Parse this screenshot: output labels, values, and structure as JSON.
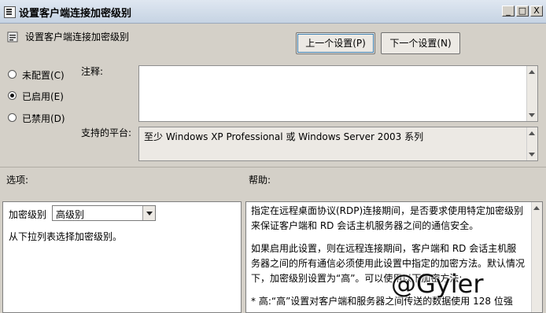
{
  "window": {
    "title": "设置客户端连接加密级别",
    "controls": {
      "minimize": "_",
      "maximize": "□",
      "close": "X"
    }
  },
  "header": {
    "setting_name": "设置客户端连接加密级别"
  },
  "nav": {
    "prev_label": "上一个设置(P)",
    "next_label": "下一个设置(N)"
  },
  "radio": {
    "not_configured": "未配置(C)",
    "enabled": "已启用(E)",
    "disabled": "已禁用(D)",
    "selected": "enabled"
  },
  "comment": {
    "label": "注释:",
    "value": ""
  },
  "platform": {
    "label": "支持的平台:",
    "value": "至少 Windows XP Professional 或 Windows Server 2003 系列"
  },
  "options": {
    "section_label": "选项:",
    "level_label": "加密级别",
    "level_value": "高级别",
    "instruction": "从下拉列表选择加密级别。"
  },
  "help": {
    "section_label": "帮助:",
    "paragraphs": [
      "指定在远程桌面协议(RDP)连接期间，是否要求使用特定加密级别来保证客户端和 RD 会话主机服务器之间的通信安全。",
      "如果启用此设置，则在远程连接期间，客户端和 RD 会话主机服务器之间的所有通信必须使用此设置中指定的加密方法。默认情况下，加密级别设置为“高”。可以使用以下加密方法:",
      "* 高:“高”设置对客户端和服务器之间传送的数据使用 128 位强"
    ]
  },
  "watermark": "@Gyier"
}
